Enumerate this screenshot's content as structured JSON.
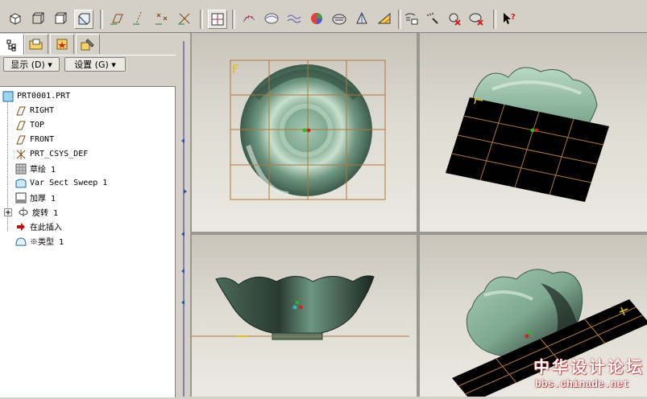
{
  "toolbar": {
    "view_buttons": [
      "shaded-cube-icon",
      "wire-cube-icon",
      "hidden-cube-icon",
      "shaded-active-cube-icon"
    ],
    "datum_buttons": [
      "datum-plane-icon",
      "datum-axis-icon",
      "datum-point-icon",
      "coord-sys-icon"
    ],
    "analysis_buttons": [
      "curvature-icon",
      "section-icon",
      "offset-icon",
      "shade-icon",
      "reflection-icon",
      "draft-icon",
      "slope-icon",
      "dihedral-icon",
      "deviation-icon",
      "node-icon",
      "gaussian-icon"
    ],
    "help_button": "whats-this-icon"
  },
  "left_panel": {
    "tabs": [
      "model-tree-tab",
      "folder-tab",
      "favorites-tab",
      "tools-tab"
    ],
    "menus": {
      "display_label": "显示 (D) ▾",
      "settings_label": "设置 (G) ▾"
    },
    "tree": [
      {
        "label": "PRT0001.PRT",
        "icon": "part-icon"
      },
      {
        "label": "RIGHT",
        "icon": "datum-plane-icon"
      },
      {
        "label": "TOP",
        "icon": "datum-plane-icon"
      },
      {
        "label": "FRONT",
        "icon": "datum-plane-icon"
      },
      {
        "label": "PRT_CSYS_DEF",
        "icon": "csys-icon"
      },
      {
        "label": "草绘 1",
        "icon": "sketch-icon"
      },
      {
        "label": "Var Sect Sweep 1",
        "icon": "sweep-icon"
      },
      {
        "label": "加厚 1",
        "icon": "thicken-icon"
      },
      {
        "label": "旋转 1",
        "icon": "revolve-icon"
      },
      {
        "label": "在此插入",
        "icon": "insert-arrow-icon"
      },
      {
        "label": "※类型 1",
        "icon": "style-icon"
      }
    ]
  },
  "viewports": [
    "top-view",
    "isometric-view-1",
    "front-view",
    "isometric-view-2"
  ],
  "watermark": {
    "line1": "中华设计论坛",
    "line2": "bbs.chinade.net"
  },
  "colors": {
    "grid": "#b0773b",
    "surface": "#8fb8a0",
    "background": "#dcd9d0"
  }
}
